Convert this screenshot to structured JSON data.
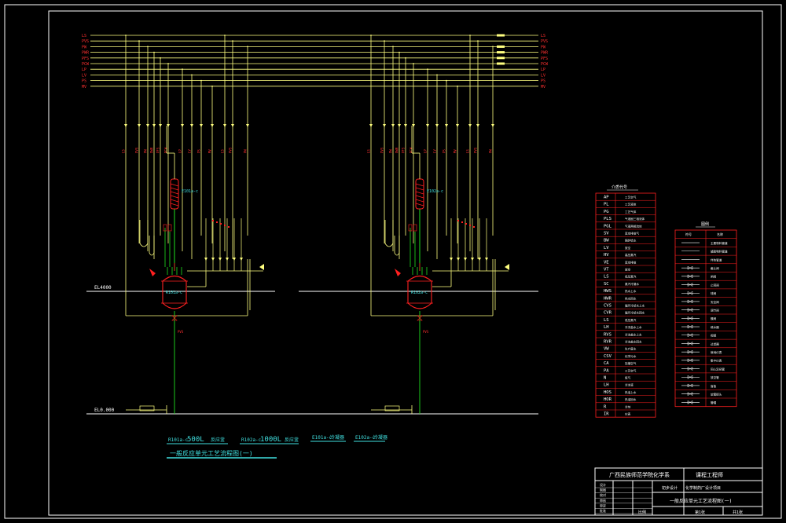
{
  "colors": {
    "background": "#000000",
    "frame": "#ffffff",
    "pipe": "#ffff80",
    "vessel": "#ff2020",
    "label": "#ff3030",
    "green": "#20e020",
    "cyan": "#40e0e0",
    "table_border": "#ff2020",
    "table_text": "#ffffff"
  },
  "bus_labels_left": [
    "LS",
    "PVS",
    "PW",
    "PWR",
    "PFS",
    "PCW",
    "LP",
    "LV",
    "PS",
    "MV"
  ],
  "bus_labels_right": [
    "LS",
    "PVS",
    "PW",
    "PWR",
    "PFS",
    "PCW",
    "LP",
    "LV",
    "PS",
    "MV"
  ],
  "elevations": {
    "upper": "EL4000",
    "lower": "EL0.000"
  },
  "units": [
    {
      "reactor_tag": "R101a-c",
      "condenser_tag": "E101a-c"
    },
    {
      "reactor_tag": "R102a-c",
      "condenser_tag": "E102a-c"
    }
  ],
  "legend": {
    "line1_tag": "R101a-c",
    "line1_text": "500L",
    "line1_suffix": "反应釜",
    "line2_tag": "R102a-c",
    "line2_text": "1000L",
    "line2_suffix": "反应釜",
    "line3_tag": "E101a-c",
    "line3_suffix": "冷凝器",
    "line4_tag": "E102a-c",
    "line4_suffix": "冷凝器",
    "drawing_title": "一般反应单元工艺流程图(一)"
  },
  "code_table": {
    "title": "介质代号",
    "rows": [
      {
        "code": "AP",
        "desc": "工艺空气"
      },
      {
        "code": "PL",
        "desc": "工艺液体"
      },
      {
        "code": "PG",
        "desc": "工艺气体"
      },
      {
        "code": "PLS",
        "desc": "气液固三相流体"
      },
      {
        "code": "PGL",
        "desc": "气液两相流体"
      },
      {
        "code": "SV",
        "desc": "真空排放气"
      },
      {
        "code": "BW",
        "desc": "锅炉给水"
      },
      {
        "code": "LV",
        "desc": "放空"
      },
      {
        "code": "HV",
        "desc": "高压蒸汽"
      },
      {
        "code": "VE",
        "desc": "真空排放"
      },
      {
        "code": "VT",
        "desc": "放空"
      },
      {
        "code": "LS",
        "desc": "低压蒸汽"
      },
      {
        "code": "SC",
        "desc": "蒸汽冷凝水"
      },
      {
        "code": "HWS",
        "desc": "热水上水"
      },
      {
        "code": "HWR",
        "desc": "热水回水"
      },
      {
        "code": "CVS",
        "desc": "循环冷却水上水"
      },
      {
        "code": "CVR",
        "desc": "循环冷却水回水"
      },
      {
        "code": "LS",
        "desc": "低压蒸汽"
      },
      {
        "code": "LH",
        "desc": "冷冻盐水上水"
      },
      {
        "code": "RVS",
        "desc": "冷冻盐水上水"
      },
      {
        "code": "RVR",
        "desc": "冷冻盐水回水"
      },
      {
        "code": "VW",
        "desc": "生产废水"
      },
      {
        "code": "CSV",
        "desc": "化学污水"
      },
      {
        "code": "CA",
        "desc": "压缩空气"
      },
      {
        "code": "PA",
        "desc": "工艺空气"
      },
      {
        "code": "N",
        "desc": "氮气"
      },
      {
        "code": "LH",
        "desc": "冷冻液"
      },
      {
        "code": "HOS",
        "desc": "热油上水"
      },
      {
        "code": "HOR",
        "desc": "热油回水"
      },
      {
        "code": "R",
        "desc": "冷剂"
      },
      {
        "code": "IR",
        "desc": "仪表"
      }
    ]
  },
  "symbol_table": {
    "title": "图例",
    "header_left": "符号",
    "header_right": "名称",
    "rows": [
      "主要物料管道",
      "辅助物料管道",
      "伴热管道",
      "截止阀",
      "闸阀",
      "止回阀",
      "球阀",
      "安全阀",
      "调节阀",
      "蝶阀",
      "疏水器",
      "视镜",
      "过滤器",
      "就地仪表",
      "集中仪表",
      "同心异径管",
      "放空管",
      "盲板",
      "软管接头",
      "管帽"
    ]
  },
  "title_block": {
    "company": "广西民族师范学院化学系",
    "department": "课程工程师",
    "drawing_name": "一般反应单元工艺流程图(一)",
    "project": "化学制药厂设计项目",
    "stage": "初步设计",
    "role_labels": [
      "设计",
      "制图",
      "校对",
      "审核",
      "审定",
      "批准"
    ],
    "sheet_label": "第1张",
    "total_label": "共1张",
    "scale_label": "比例"
  }
}
